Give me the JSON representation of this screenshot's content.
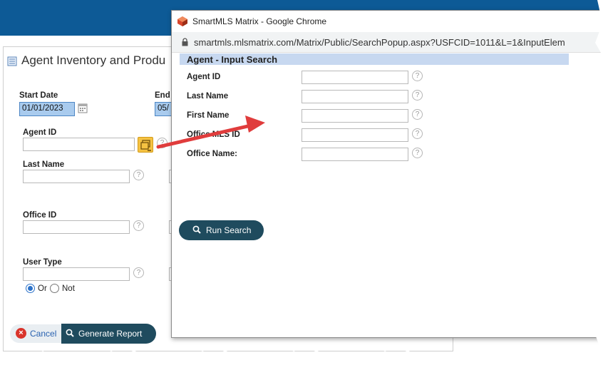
{
  "background_page": {
    "report_title": "Agent Inventory and Produ",
    "start_date_label": "Start Date",
    "start_date_value": "01/01/2023",
    "end_date_label": "End",
    "end_date_value": "05/",
    "agent_id_label": "Agent ID",
    "last_name_label": "Last Name",
    "office_id_label": "Office ID",
    "user_type_label": "User Type",
    "radio_or_label": "Or",
    "radio_not_label": "Not",
    "radio_selected": "Or",
    "cancel_label": "Cancel",
    "generate_label": "Generate Report",
    "help_glyph": "?"
  },
  "popup": {
    "window_title": "SmartMLS Matrix - Google Chrome",
    "url": "smartmls.mlsmatrix.com/Matrix/Public/SearchPopup.aspx?USFCID=1011&L=1&InputElem",
    "section_title": "Agent - Input Search",
    "fields": [
      {
        "label": "Agent ID",
        "value": ""
      },
      {
        "label": "Last Name",
        "value": ""
      },
      {
        "label": "First Name",
        "value": ""
      },
      {
        "label": "Office MLS ID",
        "value": ""
      },
      {
        "label": "Office Name:",
        "value": ""
      }
    ],
    "run_search_label": "Run Search"
  },
  "colors": {
    "header_blue": "#0d5a96",
    "button_dark": "#1f4b5e",
    "section_bar": "#c7d8f0",
    "arrow_red": "#e03c3c",
    "lookup_yellow": "#f5c242"
  }
}
